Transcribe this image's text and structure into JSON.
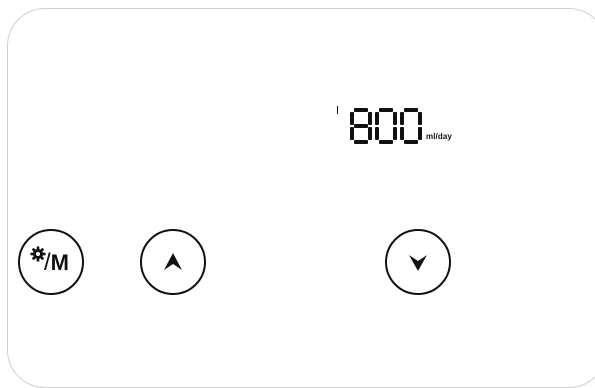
{
  "display": {
    "value": "800",
    "unit": "ml/day"
  },
  "controls": {
    "mode_button": {
      "icon": "gear-icon",
      "label": "M",
      "separator": "/"
    },
    "up_button": {
      "icon": "arrow-up-icon"
    },
    "down_button": {
      "icon": "arrow-down-icon"
    }
  }
}
